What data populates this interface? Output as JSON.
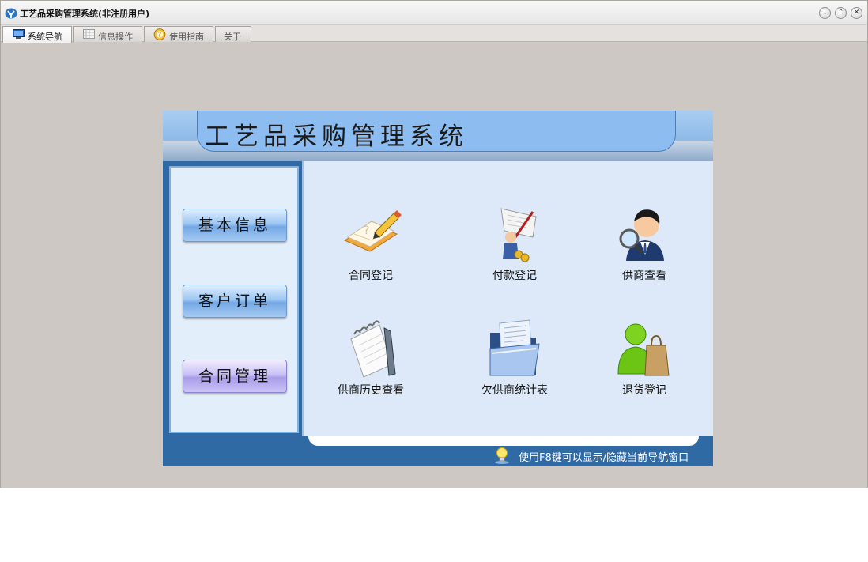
{
  "window": {
    "title": "工艺品采购管理系统(非注册用户)",
    "buttons": {
      "minimize": "⌄",
      "maximize": "⌃",
      "close": "✕"
    }
  },
  "tabs": [
    {
      "label": "系统导航",
      "icon": "monitor-icon",
      "active": true
    },
    {
      "label": "信息操作",
      "icon": "grid-icon",
      "active": false
    },
    {
      "label": "使用指南",
      "icon": "help-icon",
      "active": false
    },
    {
      "label": "关于",
      "icon": "",
      "active": false
    }
  ],
  "panel": {
    "title": "工艺品采购管理系统",
    "sidebar": [
      {
        "label": "基本信息",
        "style": "blue"
      },
      {
        "label": "客户订单",
        "style": "blue"
      },
      {
        "label": "合同管理",
        "style": "purple"
      }
    ],
    "items": [
      {
        "label": "合同登记",
        "icon": "notebook-pencil-icon"
      },
      {
        "label": "付款登记",
        "icon": "payment-person-icon"
      },
      {
        "label": "供商查看",
        "icon": "person-magnifier-icon"
      },
      {
        "label": "供商历史查看",
        "icon": "notepad-icon"
      },
      {
        "label": "欠供商统计表",
        "icon": "folder-documents-icon"
      },
      {
        "label": "退货登记",
        "icon": "user-shopping-bag-icon"
      }
    ],
    "tip": "使用F8键可以显示/隐藏当前导航窗口"
  },
  "colors": {
    "panel_bg": "#2f6aa5",
    "content_bg": "#dde9f8",
    "header": "#8dbdf0"
  }
}
